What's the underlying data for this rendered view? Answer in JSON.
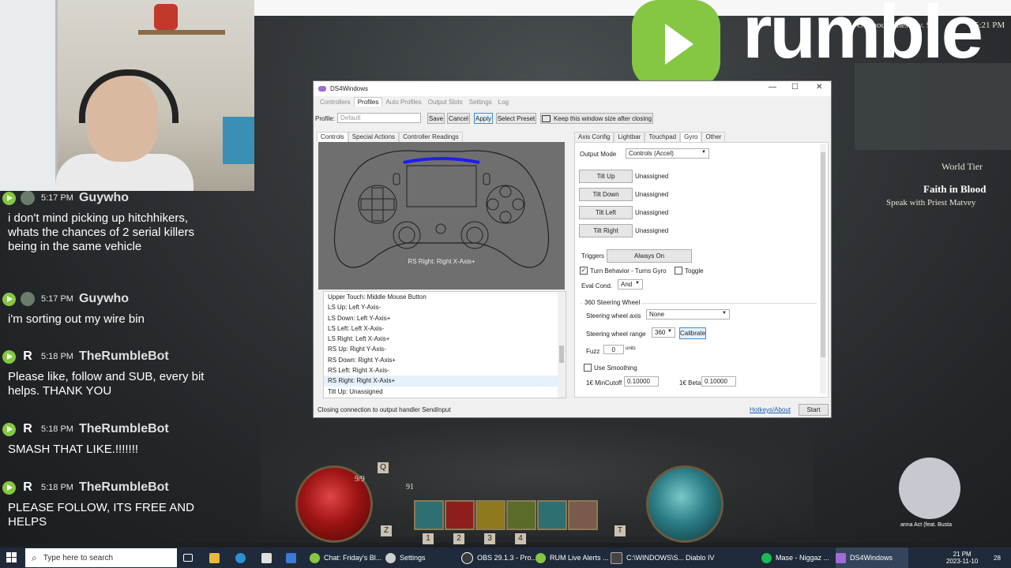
{
  "chat": {
    "messages": [
      {
        "time": "5:17 PM",
        "user": "Guywho",
        "text": "i don't mind picking up hitchhikers, whats the chances of 2 serial killers being in the same vehicle"
      },
      {
        "time": "5:17 PM",
        "user": "Guywho",
        "text": "i'm sorting out my wire bin"
      },
      {
        "time": "5:18 PM",
        "user": "TheRumbleBot",
        "avatar": "R",
        "text": "Please like, follow and SUB, every bit helps. THANK YOU"
      },
      {
        "time": "5:18 PM",
        "user": "TheRumbleBot",
        "avatar": "R",
        "text": "SMASH THAT LIKE.!!!!!!!"
      },
      {
        "time": "5:18 PM",
        "user": "TheRumbleBot",
        "avatar": "R",
        "text": "PLEASE FOLLOW, ITS FREE AND HELPS"
      }
    ]
  },
  "overlay": {
    "brand": "rumble"
  },
  "game_hud": {
    "quest_title": "Ominous Chest (lv. 91)",
    "clock": "5:21 PM",
    "world_tier": "World Tier",
    "objective": "Faith in Blood",
    "objective_sub": "Speak with Priest Matvey",
    "potion_count": "9/9",
    "level": "91",
    "skill_keys": [
      "1",
      "2",
      "3",
      "4"
    ],
    "key_z": "Z",
    "key_t": "T",
    "key_q": "Q",
    "now_playing": "anna Act (feat. Busta"
  },
  "ds4": {
    "title": "DS4Windows",
    "main_tabs": [
      "Controllers",
      "Profiles",
      "Auto Profiles",
      "Output Slots",
      "Settings",
      "Log"
    ],
    "profile_label": "Profile:",
    "profile_value": "Default",
    "buttons": {
      "save": "Save",
      "cancel": "Cancel",
      "apply": "Apply",
      "select_preset": "Select Preset",
      "keep_size": "Keep this window size after closing"
    },
    "left_tabs": [
      "Controls",
      "Special Actions",
      "Controller Readings"
    ],
    "controller_caption": "RS Right: Right X-Axis+",
    "mapping_list": [
      "Upper Touch: Middle Mouse Button",
      "LS Up: Left Y-Axis-",
      "LS Down: Left Y-Axis+",
      "LS Left: Left X-Axis-",
      "LS Right: Left X-Axis+",
      "RS Up: Right Y-Axis-",
      "RS Down: Right Y-Axis+",
      "RS Left: Right X-Axis-",
      "RS Right: Right X-Axis+",
      "Tilt Up: Unassigned"
    ],
    "selected_index": 8,
    "right_tabs": [
      "Axis Config",
      "Lightbar",
      "Touchpad",
      "Gyro",
      "Other"
    ],
    "output_mode_label": "Output Mode",
    "output_mode_value": "Controls (Accel)",
    "tilts": [
      {
        "label": "Tilt Up",
        "value": "Unassigned"
      },
      {
        "label": "Tilt Down",
        "value": "Unassigned"
      },
      {
        "label": "Tilt Left",
        "value": "Unassigned"
      },
      {
        "label": "Tilt Right",
        "value": "Unassigned"
      }
    ],
    "triggers_label": "Triggers",
    "triggers_value": "Always On",
    "turn_behavior": "Turn Behavior - Turns Gyro",
    "toggle": "Toggle",
    "eval_label": "Eval Cond.",
    "eval_value": "And",
    "steering_group": "360 Steering Wheel",
    "steer_axis_label": "Steering wheel axis",
    "steer_axis_value": "None",
    "steer_range_label": "Steering wheel range",
    "steer_range_value": "360",
    "calibrate": "Calibrate",
    "fuzz_label": "Fuzz",
    "fuzz_value": "0",
    "fuzz_unit": "units",
    "use_smoothing": "Use Smoothing",
    "mincutoff_label": "1€ MinCutoff",
    "mincutoff_value": "0.10000",
    "beta_label": "1€ Beta",
    "beta_value": "0.10000",
    "status": "Closing connection to output handler SendInput",
    "hotkeys": "Hotkeys/About",
    "start": "Start"
  },
  "taskbar": {
    "search_placeholder": "Type here to search",
    "items": [
      {
        "label": "Chat: Friday's Bl...",
        "color": "#85c742"
      },
      {
        "label": "Settings",
        "color": "#cfcfcf"
      },
      {
        "label": "OBS 29.1.3 - Pro...",
        "color": "#3a3a3a"
      },
      {
        "label": "RUM Live Alerts ...",
        "color": "#85c742"
      },
      {
        "label": "C:\\WINDOWS\\S...",
        "color": "#444444"
      },
      {
        "label": "Diablo IV",
        "color": "#8b1c1c"
      },
      {
        "label": "Mase - Niggaz ...",
        "color": "#1db954"
      },
      {
        "label": "DS4Windows",
        "color": "#a06ad8"
      }
    ],
    "time": "21 PM",
    "date": "2023-11-10",
    "notif": "28"
  },
  "colors": {
    "rumble_green": "#85c742",
    "lightbar": "#1d1df0"
  }
}
